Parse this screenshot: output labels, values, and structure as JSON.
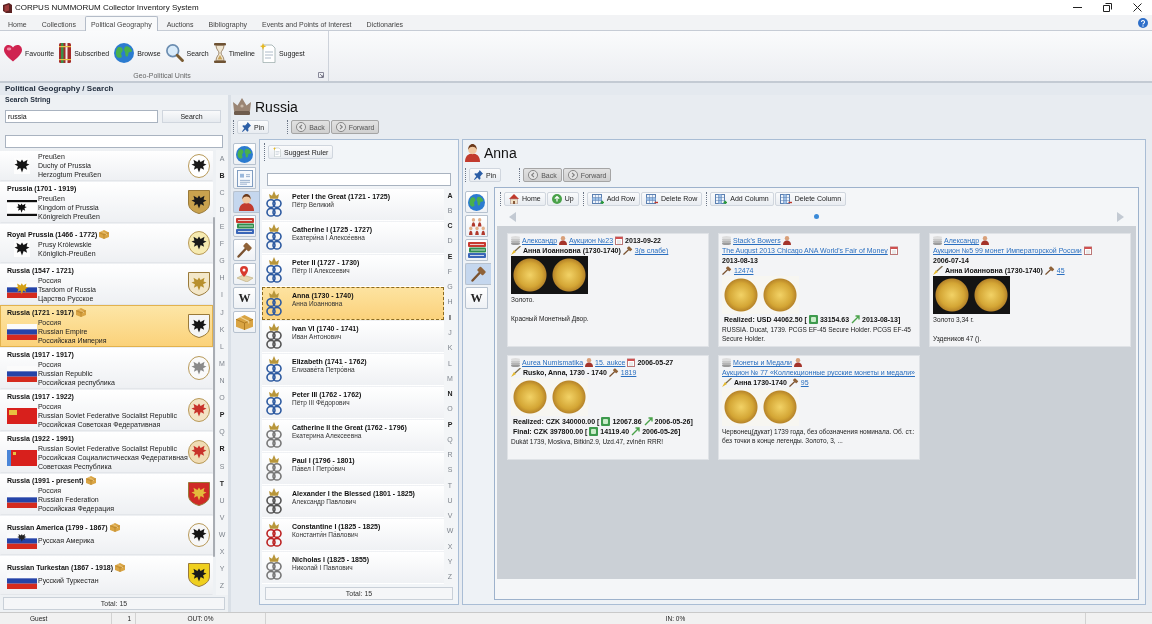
{
  "window": {
    "title": "CORPUS NUMMORUM Collector Inventory System"
  },
  "menu_tabs": [
    {
      "label": "Home",
      "selected": false
    },
    {
      "label": "Collections",
      "selected": false
    },
    {
      "label": "Political Geography",
      "selected": true
    },
    {
      "label": "Auctions",
      "selected": false
    },
    {
      "label": "Bibliography",
      "selected": false
    },
    {
      "label": "Events and Points of Interest",
      "selected": false
    },
    {
      "label": "Dictionaries",
      "selected": false
    }
  ],
  "ribbon": {
    "buttons": [
      {
        "label": "Favourite"
      },
      {
        "label": "Subscribed"
      },
      {
        "label": "Browse"
      },
      {
        "label": "Search"
      },
      {
        "label": "Timeline"
      },
      {
        "label": "Suggest"
      }
    ],
    "group_label": "Geo-Political Units"
  },
  "breadcrumb": "Political Geography / Search",
  "search_panel": {
    "label": "Search String",
    "query": "russia",
    "search_button": "Search",
    "units": [
      {
        "names": [
          "Preußen",
          "Duchy of Prussia",
          "Herzogtum Preußen"
        ],
        "marked": false,
        "selected": false
      },
      {
        "title": "Prussia (1701 - 1919)",
        "names": [
          "Preußen",
          "Kingdom of Prussia",
          "Königreich Preußen"
        ],
        "marked": false,
        "selected": false
      },
      {
        "title": "Royal Prussia (1466 - 1772)",
        "names": [
          "Prusy Królewskie",
          "Königlich-Preußen"
        ],
        "marked": true,
        "selected": false
      },
      {
        "title": "Russia (1547 - 1721)",
        "names": [
          "Россия",
          "Tsardom of Russia",
          "Царство Русское"
        ],
        "marked": false,
        "selected": false
      },
      {
        "title": "Russia (1721 - 1917)",
        "names": [
          "Россия",
          "Russian Empire",
          "Российская Империя"
        ],
        "marked": true,
        "selected": true
      },
      {
        "title": "Russia (1917 - 1917)",
        "names": [
          "Россия",
          "Russian Republic",
          "Российская республика"
        ],
        "marked": false,
        "selected": false
      },
      {
        "title": "Russia (1917 - 1922)",
        "names": [
          "Россия",
          "Russian Soviet Federative Socialist Republic",
          "Российская Советская Федеративная"
        ],
        "marked": false,
        "selected": false
      },
      {
        "title": "Russia (1922 - 1991)",
        "names": [
          "Russian Soviet Federative Socialist Republic",
          "Российская Социалистическая Федеративная",
          "Советская Республика"
        ],
        "marked": false,
        "selected": false
      },
      {
        "title": "Russia (1991 - present)",
        "names": [
          "Россия",
          "Russian Federation",
          "Российская Федерация"
        ],
        "marked": true,
        "selected": false
      },
      {
        "title": "Russian America (1799 - 1867)",
        "names": [
          "Русская Америка"
        ],
        "marked": true,
        "selected": false
      },
      {
        "title": "Russian Turkestan (1867 - 1918)",
        "names": [
          "Русский Туркестан"
        ],
        "marked": true,
        "selected": false
      }
    ],
    "index": [
      {
        "letter": "A",
        "enabled": false
      },
      {
        "letter": "B",
        "enabled": true
      },
      {
        "letter": "C",
        "enabled": false
      },
      {
        "letter": "D",
        "enabled": false
      },
      {
        "letter": "E",
        "enabled": false
      },
      {
        "letter": "F",
        "enabled": false
      },
      {
        "letter": "G",
        "enabled": false
      },
      {
        "letter": "H",
        "enabled": false
      },
      {
        "letter": "I",
        "enabled": false
      },
      {
        "letter": "J",
        "enabled": false
      },
      {
        "letter": "K",
        "enabled": false
      },
      {
        "letter": "L",
        "enabled": false
      },
      {
        "letter": "M",
        "enabled": false
      },
      {
        "letter": "N",
        "enabled": false
      },
      {
        "letter": "O",
        "enabled": false
      },
      {
        "letter": "P",
        "enabled": true
      },
      {
        "letter": "Q",
        "enabled": false
      },
      {
        "letter": "R",
        "enabled": true
      },
      {
        "letter": "S",
        "enabled": false
      },
      {
        "letter": "T",
        "enabled": true
      },
      {
        "letter": "U",
        "enabled": false
      },
      {
        "letter": "V",
        "enabled": false
      },
      {
        "letter": "W",
        "enabled": false
      },
      {
        "letter": "X",
        "enabled": false
      },
      {
        "letter": "Y",
        "enabled": false
      },
      {
        "letter": "Z",
        "enabled": false
      }
    ],
    "total": "Total: 15"
  },
  "unit_view": {
    "title": "Russia",
    "toolbar": [
      [
        {
          "label": "Pin",
          "disabled": false
        }
      ],
      [
        {
          "label": "Back",
          "disabled": true
        },
        {
          "label": "Forward",
          "disabled": true
        }
      ]
    ],
    "side_tabs": [
      {
        "selected": false
      },
      {
        "selected": false
      },
      {
        "selected": true
      },
      {
        "selected": false
      },
      {
        "selected": false
      },
      {
        "selected": false
      },
      {
        "label": "W",
        "selected": false
      },
      {
        "selected": false
      }
    ],
    "rulers": {
      "suggest_button": "Suggest Ruler",
      "items": [
        {
          "name": "Peter I the Great (1721 - 1725)",
          "native": "Пётр Великий",
          "selected": false
        },
        {
          "name": "Catherine I (1725 - 1727)",
          "native": "Екатери́на I Алексе́евна",
          "selected": false
        },
        {
          "name": "Peter II (1727 - 1730)",
          "native": "Пётр II Алексеевич",
          "selected": false
        },
        {
          "name": "Anna (1730 - 1740)",
          "native": "Анна Иоанновна",
          "selected": true
        },
        {
          "name": "Ivan VI (1740 - 1741)",
          "native": "Иван Антонович",
          "selected": false
        },
        {
          "name": "Elizabeth (1741 - 1762)",
          "native": "Елизаве́та Петро́вна",
          "selected": false
        },
        {
          "name": "Peter III (1762 - 1762)",
          "native": "Пётр III Фёдорович",
          "selected": false
        },
        {
          "name": "Catherine II the Great (1762 - 1796)",
          "native": "Екатерина Алексеевна",
          "selected": false
        },
        {
          "name": "Paul I (1796 - 1801)",
          "native": "Па́вел I Петро́вич",
          "selected": false
        },
        {
          "name": "Alexander I the Blessed (1801 - 1825)",
          "native": "Александр Павлович",
          "selected": false
        },
        {
          "name": "Constantine I (1825 - 1825)",
          "native": "Константи́н Па́влович",
          "selected": false
        },
        {
          "name": "Nicholas I (1825 - 1855)",
          "native": "Николай I Павлович",
          "selected": false
        }
      ],
      "index": [
        {
          "letter": "A",
          "enabled": true
        },
        {
          "letter": "B",
          "enabled": false
        },
        {
          "letter": "C",
          "enabled": true
        },
        {
          "letter": "D",
          "enabled": false
        },
        {
          "letter": "E",
          "enabled": true
        },
        {
          "letter": "F",
          "enabled": false
        },
        {
          "letter": "G",
          "enabled": false
        },
        {
          "letter": "H",
          "enabled": false
        },
        {
          "letter": "I",
          "enabled": true
        },
        {
          "letter": "J",
          "enabled": false
        },
        {
          "letter": "K",
          "enabled": false
        },
        {
          "letter": "L",
          "enabled": false
        },
        {
          "letter": "M",
          "enabled": false
        },
        {
          "letter": "N",
          "enabled": true
        },
        {
          "letter": "O",
          "enabled": false
        },
        {
          "letter": "P",
          "enabled": true
        },
        {
          "letter": "Q",
          "enabled": false
        },
        {
          "letter": "R",
          "enabled": false
        },
        {
          "letter": "S",
          "enabled": false
        },
        {
          "letter": "T",
          "enabled": false
        },
        {
          "letter": "U",
          "enabled": false
        },
        {
          "letter": "V",
          "enabled": false
        },
        {
          "letter": "W",
          "enabled": false
        },
        {
          "letter": "X",
          "enabled": false
        },
        {
          "letter": "Y",
          "enabled": false
        },
        {
          "letter": "Z",
          "enabled": false
        }
      ],
      "total": "Total: 15"
    }
  },
  "ruler_view": {
    "title": "Anna",
    "toolbar": [
      [
        {
          "label": "Pin",
          "disabled": false
        }
      ],
      [
        {
          "label": "Back",
          "disabled": true
        },
        {
          "label": "Forward",
          "disabled": true
        }
      ]
    ],
    "side_tabs": [
      {
        "selected": false
      },
      {
        "selected": false
      },
      {
        "selected": false
      },
      {
        "selected": true
      },
      {
        "label": "W",
        "selected": false
      }
    ],
    "grid_toolbar": [
      [
        {
          "label": "Home"
        },
        {
          "label": "Up"
        }
      ],
      [
        {
          "label": "Add Row"
        },
        {
          "label": "Delete Row"
        }
      ],
      [
        {
          "label": "Add Column"
        },
        {
          "label": "Delete Column"
        }
      ]
    ],
    "lots": [
      {
        "seller": "Александр",
        "auction": "Аукцион №23",
        "date": "2013-09-22",
        "title": "Анна Иоанновна (1730-1740)",
        "lot": "3(в слабе)",
        "description": [
          "Золото.",
          "Красный Монетный Двор."
        ]
      },
      {
        "seller": "Stack's Bowers",
        "auction": "The August 2013 Chicago ANA World's Fair of Money",
        "date": "2013-08-13",
        "lot": "12474",
        "prices": [
          {
            "label": "Realized: USD 44062.50 [",
            "converted": "33154.63",
            "date": "2013-08-13]"
          }
        ],
        "description": [
          "RUSSIA. Ducat, 1739. PCGS EF-45 Secure Holder. PCGS EF-45 Secure Holder."
        ]
      },
      {
        "seller": "Александр",
        "auction": "Аукцион №5 99 монет Императорской России",
        "date": "2006-07-14",
        "title": "Анна Иоанновна (1730-1740)",
        "lot": "45",
        "description": [
          "Золото 3,34 г.",
          "Уздеников 47 ()."
        ]
      },
      {
        "seller": "Aurea Numismatika",
        "auction": "15. aukce",
        "date": "2006-05-27",
        "title": "Rusko, Anna, 1730 - 1740",
        "lot": "1819",
        "prices": [
          {
            "label": "Realized: CZK 340000.00 [",
            "converted": "12067.86",
            "date": "2006-05-26]"
          },
          {
            "label": "Final: CZK 397800.00 [",
            "converted": "14119.40",
            "date": "2006-05-26]"
          }
        ],
        "description": [
          "Dukát 1739, Moskva, Bitkin2.9, Uzd.47, zvlněn RRR!"
        ]
      },
      {
        "seller": "Монеты и Медали",
        "auction": "Аукцион № 77 «Коллекционные русские монеты и медали»",
        "title": "Анна 1730-1740",
        "lot": "95",
        "description": [
          "Червонец(дукат) 1739 года, без обозначения номинала. Об. ст.: без точки в конце легенды. Золото, 3, ..."
        ]
      }
    ]
  },
  "status_bar": {
    "user": "Guest",
    "count": "1",
    "out": "OUT: 0%",
    "in": "IN: 0%"
  }
}
